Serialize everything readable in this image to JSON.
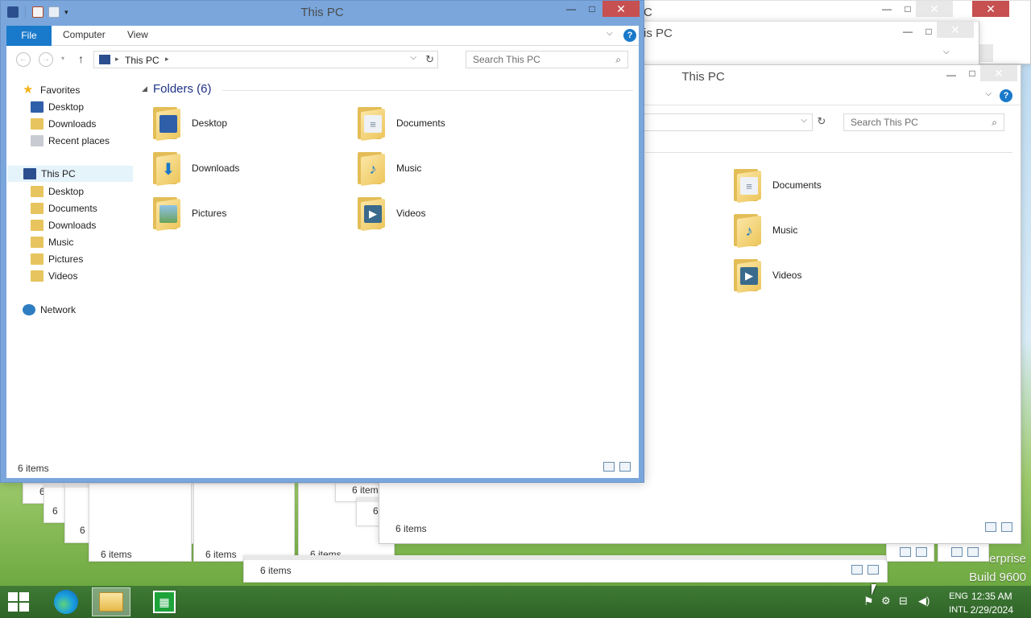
{
  "desktop": {
    "edition_partial": "erprise",
    "build": "Build 9600"
  },
  "main_window": {
    "title": "This PC",
    "ribbon": {
      "file": "File",
      "tabs": [
        "Computer",
        "View"
      ]
    },
    "address": "This PC",
    "search_placeholder": "Search This PC",
    "nav": {
      "favorites": "Favorites",
      "favorites_items": [
        "Desktop",
        "Downloads",
        "Recent places"
      ],
      "this_pc": "This PC",
      "this_pc_items": [
        "Desktop",
        "Documents",
        "Downloads",
        "Music",
        "Pictures",
        "Videos"
      ],
      "network": "Network"
    },
    "group_title": "Folders (6)",
    "folders": [
      "Desktop",
      "Documents",
      "Downloads",
      "Music",
      "Pictures",
      "Videos"
    ],
    "status": "6 items"
  },
  "back_window_1": {
    "title": "This PC",
    "status": "6 items",
    "search_placeholder": "Search This PC",
    "folders": [
      "Documents",
      "Music",
      "Videos"
    ]
  },
  "back_window_2": {
    "title_partial": "is PC"
  },
  "back_window_3": {
    "title_partial": "C"
  },
  "stacked_status": [
    "6",
    "6",
    "6",
    "6",
    "6",
    "6",
    "6 items",
    "6 items",
    "6 items",
    "6 item",
    "6",
    "6 items"
  ],
  "taskbar": {
    "lang": "ENG",
    "layout": "INTL",
    "time": "12:35 AM",
    "date": "2/29/2024"
  },
  "colors": {
    "accent": "#1979ca",
    "frame": "#7aa6dc",
    "close": "#c75050",
    "taskbar": "#3a7231"
  }
}
